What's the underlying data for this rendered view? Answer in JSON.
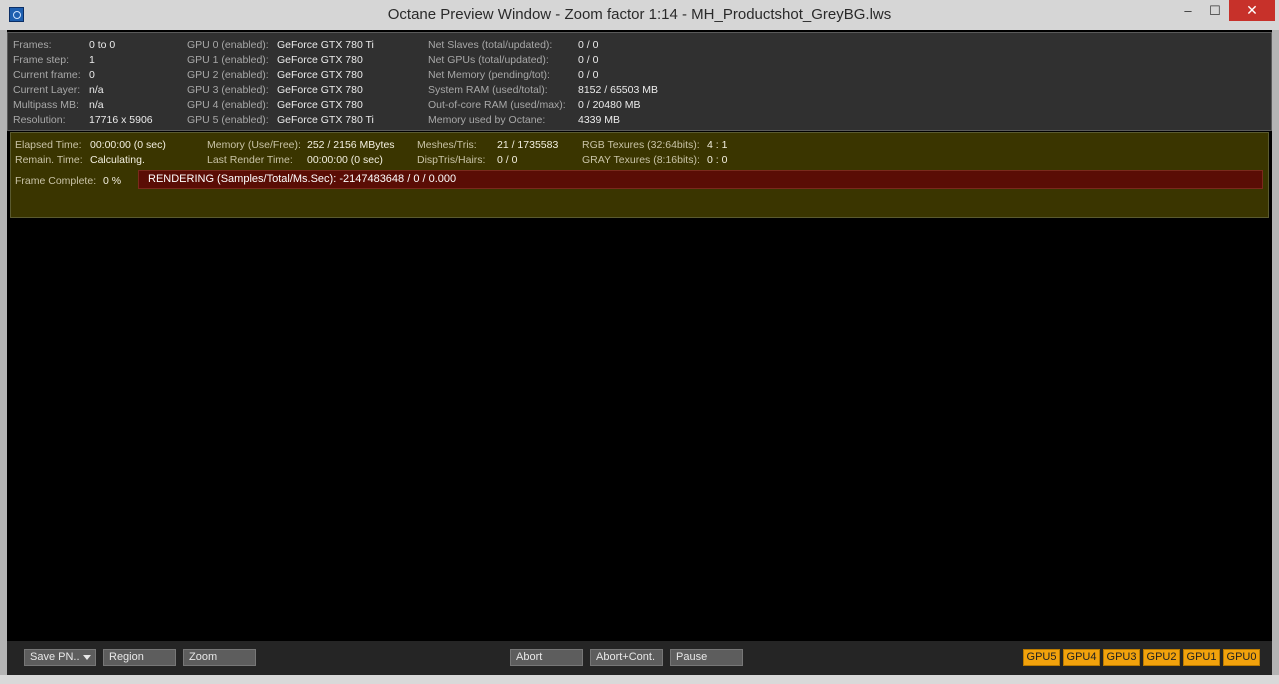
{
  "window": {
    "title": "Octane Preview Window - Zoom factor 1:14 - MH_Productshot_GreyBG.lws",
    "controls": {
      "minimize": "‒",
      "maximize": "☐",
      "close": "✕"
    }
  },
  "info": {
    "col1": [
      {
        "label": "Frames:",
        "value": "0 to 0"
      },
      {
        "label": "Frame step:",
        "value": "1"
      },
      {
        "label": "Current frame:",
        "value": "0"
      },
      {
        "label": "Current Layer:",
        "value": "n/a"
      },
      {
        "label": "Multipass MB:",
        "value": "n/a"
      },
      {
        "label": "Resolution:",
        "value": "17716 x 5906"
      }
    ],
    "gpus": [
      {
        "label": "GPU  0 (enabled):",
        "value": "GeForce GTX 780 Ti"
      },
      {
        "label": "GPU  1 (enabled):",
        "value": "GeForce GTX 780"
      },
      {
        "label": "GPU  2 (enabled):",
        "value": "GeForce GTX 780"
      },
      {
        "label": "GPU  3 (enabled):",
        "value": "GeForce GTX 780"
      },
      {
        "label": "GPU  4 (enabled):",
        "value": "GeForce GTX 780"
      },
      {
        "label": "GPU  5 (enabled):",
        "value": "GeForce GTX 780 Ti"
      }
    ],
    "col3": [
      {
        "label": "Net Slaves (total/updated):",
        "value": "0 / 0"
      },
      {
        "label": "Net GPUs (total/updated):",
        "value": "0 / 0"
      },
      {
        "label": "Net Memory (pending/tot):",
        "value": "0 / 0"
      },
      {
        "label": "System RAM (used/total):",
        "value": "8152 / 65503 MB"
      },
      {
        "label": "Out-of-core RAM (used/max):",
        "value": "0 / 20480 MB"
      },
      {
        "label": "Memory used by Octane:",
        "value": "4339 MB"
      }
    ]
  },
  "status": {
    "elapsed": {
      "label": "Elapsed Time:",
      "value": "00:00:00 (0 sec)"
    },
    "remain": {
      "label": "Remain. Time:",
      "value": "Calculating."
    },
    "memory": {
      "label": "Memory (Use/Free):",
      "value": "252 / 2156 MBytes"
    },
    "last_render": {
      "label": "Last Render Time:",
      "value": "00:00:00 (0 sec)"
    },
    "meshes": {
      "label": "Meshes/Tris:",
      "value": "21 / 1735583"
    },
    "disp": {
      "label": "DispTris/Hairs:",
      "value": "0 / 0"
    },
    "rgb_tex": {
      "label": "RGB Texures (32:64bits):",
      "value": "4 : 1"
    },
    "gray_tex": {
      "label": "GRAY Texures (8:16bits):",
      "value": "0 : 0"
    },
    "frame_complete": {
      "label": "Frame Complete:",
      "value": "0 %"
    },
    "rendering": "RENDERING (Samples/Total/Ms.Sec): -2147483648 / 0 / 0.000"
  },
  "toolbar": {
    "save": "Save PN..",
    "region": "Region",
    "zoom": "Zoom",
    "abort": "Abort",
    "abort_cont": "Abort+Cont.",
    "pause": "Pause",
    "gpus": [
      "GPU5",
      "GPU4",
      "GPU3",
      "GPU2",
      "GPU1",
      "GPU0"
    ]
  },
  "colors": {
    "gpu_button": "#f2a20c",
    "render_bar": "#5a0d05",
    "status_panel": "#3a3500"
  }
}
